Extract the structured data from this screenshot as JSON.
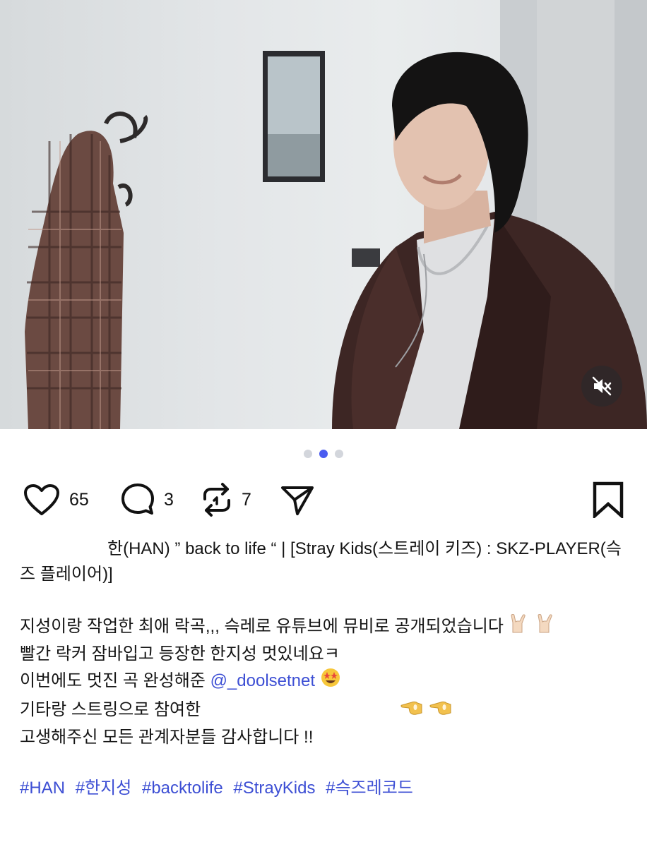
{
  "media": {
    "image_alt": "Music video still: man in brown jacket leaning against a white wall, plaid shirt hanging on a coat hook, small mirror on wall",
    "mute_icon": "speaker-muted-icon"
  },
  "carousel": {
    "total": 3,
    "active_index": 1
  },
  "actions": {
    "likes": "65",
    "comments": "3",
    "reposts": "7"
  },
  "caption": {
    "title": "한(HAN) ” back to life “ | [Stray Kids(스트레이 키즈) : SKZ-PLAYER(슥즈 플레이어)]",
    "line1": "지성이랑 작업한 최애 락곡,,, 슥레로 유튜브에 뮤비로 공개되었습니다",
    "line2": "빨간 락커 잠바입고 등장한 한지성 멋있네요ㅋ",
    "line3_prefix": "이번에도 멋진 곡 완성해준",
    "mention": "@_doolsetnet",
    "line4": "기타랑 스트링으로 참여한",
    "line5": "고생해주신 모든 관계자분들 감사합니다 !!",
    "hashtags": [
      "#HAN",
      "#한지성",
      "#backtolife",
      "#StrayKids",
      "#슥즈레코드"
    ]
  },
  "colors": {
    "accent": "#3d4fd4",
    "dot_active": "#4a5cf0",
    "dot_inactive": "#d3d6dc"
  }
}
